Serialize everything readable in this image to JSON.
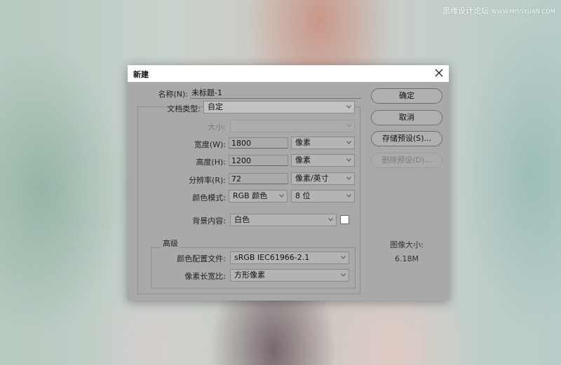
{
  "watermark": {
    "site": "思缘设计论坛",
    "url": "WWW.MISSYUAN.COM"
  },
  "dialog": {
    "title": "新建",
    "name": {
      "label": "名称(N):",
      "value": "未标题-1"
    },
    "preset": {
      "label": "文档类型:",
      "value": "自定"
    },
    "size": {
      "label": "大小:",
      "value": ""
    },
    "width": {
      "label": "宽度(W):",
      "value": "1800",
      "unit": "像素"
    },
    "height": {
      "label": "高度(H):",
      "value": "1200",
      "unit": "像素"
    },
    "resolution": {
      "label": "分辨率(R):",
      "value": "72",
      "unit": "像素/英寸"
    },
    "color_mode": {
      "label": "颜色模式:",
      "mode": "RGB 颜色",
      "depth": "8 位"
    },
    "background": {
      "label": "背景内容:",
      "value": "白色",
      "swatch_color": "#ffffff"
    },
    "advanced": {
      "legend": "高级",
      "color_profile": {
        "label": "颜色配置文件:",
        "value": "sRGB IEC61966-2.1"
      },
      "pixel_aspect": {
        "label": "像素长宽比:",
        "value": "方形像素"
      }
    },
    "buttons": {
      "ok": "确定",
      "cancel": "取消",
      "save_preset": "存储预设(S)...",
      "delete_preset": "删除预设(D)..."
    },
    "image_size": {
      "label": "图像大小:",
      "value": "6.18M"
    }
  }
}
